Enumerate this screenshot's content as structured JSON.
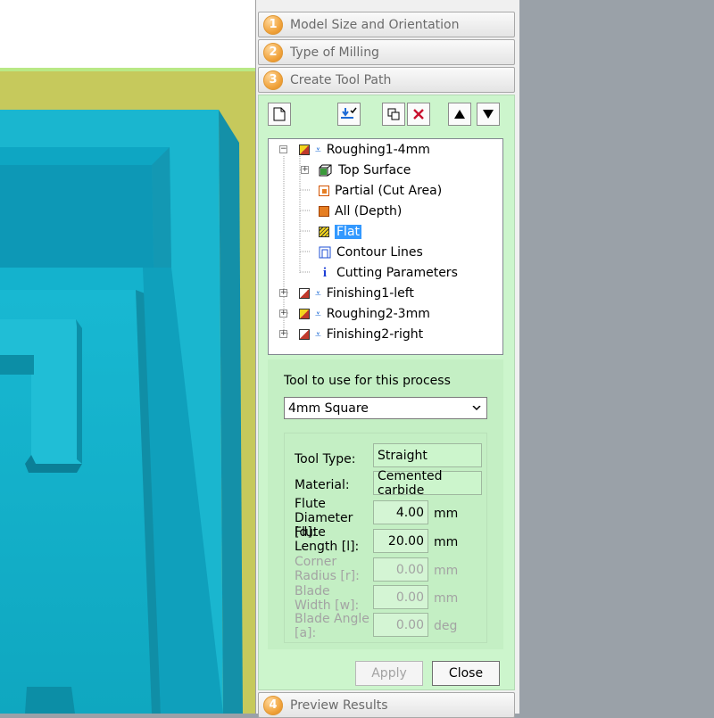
{
  "steps": [
    {
      "num": "1",
      "label": "Model Size and Orientation"
    },
    {
      "num": "2",
      "label": "Type of Milling"
    },
    {
      "num": "3",
      "label": "Create Tool Path"
    },
    {
      "num": "4",
      "label": "Preview Results"
    }
  ],
  "toolbar": {
    "new_icon": "new-document-icon",
    "tool_icon": "tool-check-icon",
    "copy_icon": "copy-icon",
    "delete_icon": "delete-x-icon",
    "up_icon": "up-arrow-icon",
    "down_icon": "down-arrow-icon"
  },
  "tree": {
    "roughing1": "Roughing1-4mm",
    "top_surface": "Top Surface",
    "partial": "Partial (Cut Area)",
    "all_depth": "All (Depth)",
    "flat": "Flat",
    "contour": "Contour Lines",
    "cutting": "Cutting Parameters",
    "finishing1": "Finishing1-left",
    "roughing2": "Roughing2-3mm",
    "finishing2": "Finishing2-right"
  },
  "tool": {
    "section_label": "Tool to use for this process",
    "selected": "4mm Square",
    "type_label": "Tool Type:",
    "type_value": "Straight",
    "material_label": "Material:",
    "material_value": "Cemented carbide",
    "flute_diameter_label": "Flute Diameter [d]:",
    "flute_diameter_value": "4.00",
    "flute_length_label": "Flute Length [l]:",
    "flute_length_value": "20.00",
    "corner_radius_label": "Corner Radius [r]:",
    "corner_radius_value": "0.00",
    "blade_width_label": "Blade Width [w]:",
    "blade_width_value": "0.00",
    "blade_angle_label": "Blade Angle [a]:",
    "blade_angle_value": "0.00",
    "unit_mm": "mm",
    "unit_deg": "deg"
  },
  "buttons": {
    "apply": "Apply",
    "close": "Close"
  },
  "colors": {
    "panel_green": "#ccf5cc",
    "model_cyan": "#00b4d0",
    "selection": "#3399ff",
    "step_orange": "#f0a23a"
  }
}
